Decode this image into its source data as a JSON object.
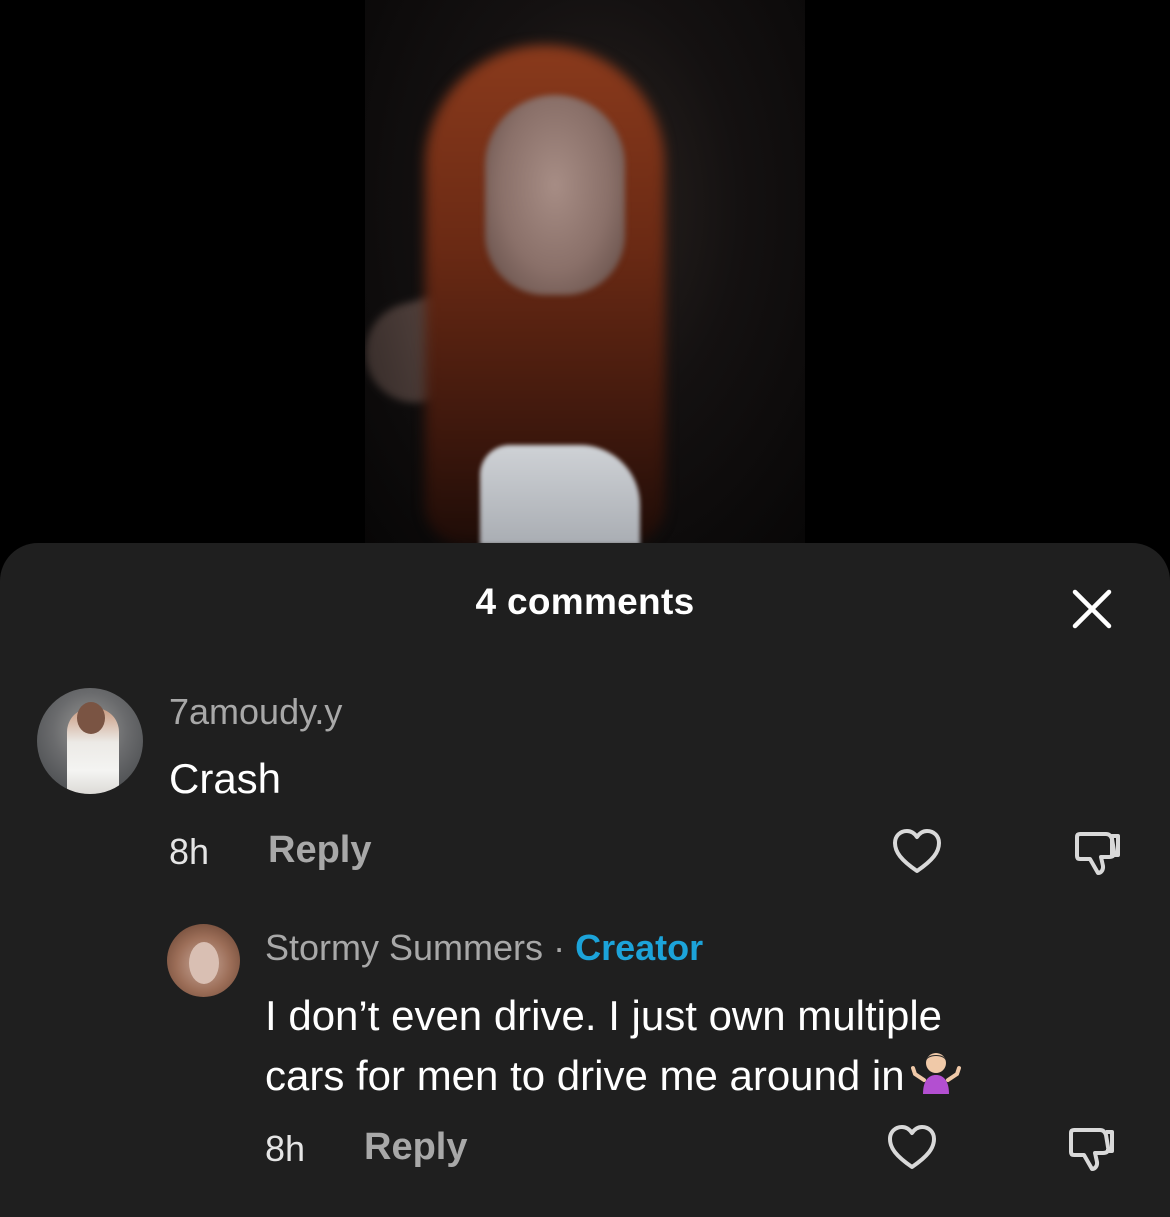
{
  "video": {
    "description_icon": "video-thumbnail"
  },
  "sheet": {
    "title": "4 comments",
    "close_icon": "close-icon"
  },
  "comments": [
    {
      "username": "7amoudy.y",
      "text": "Crash",
      "time": "8h",
      "reply_label": "Reply",
      "like_icon": "heart-outline-icon",
      "dislike_icon": "thumbs-down-icon"
    },
    {
      "username": "Stormy Summers",
      "separator": "·",
      "badge": "Creator",
      "text_line1": "I don’t even drive. I just own multiple",
      "text_line2": "cars for men to drive me around in",
      "emoji": "person-shrugging-emoji",
      "time": "8h",
      "reply_label": "Reply",
      "like_icon": "heart-outline-icon",
      "dislike_icon": "thumbs-down-icon"
    }
  ],
  "colors": {
    "sheet_bg": "#1f1f1f",
    "username": "#a8a8a8",
    "creator_badge": "#1ca3d9",
    "text": "#ffffff"
  }
}
